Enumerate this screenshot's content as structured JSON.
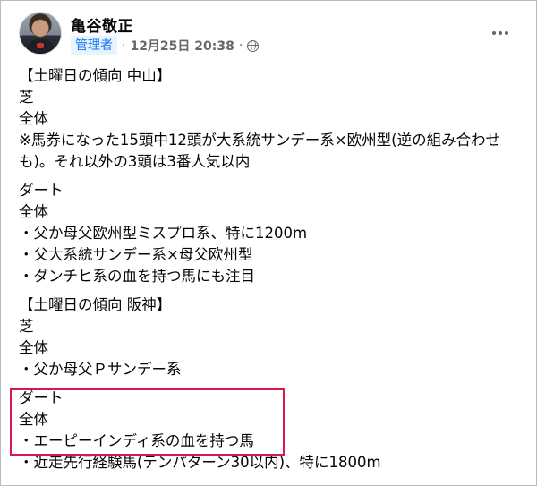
{
  "author": {
    "name": "亀谷敬正",
    "role_badge": "管理者",
    "separator": "·",
    "timestamp": "12月25日 20:38",
    "audience_icon": "globe-icon"
  },
  "post": {
    "sections": [
      {
        "lines": [
          "【土曜日の傾向 中山】",
          "芝",
          "全体",
          "※馬券になった15頭中12頭が大系統サンデー系×欧州型(逆の組み合わせも)。それ以外の3頭は3番人気以内"
        ]
      },
      {
        "lines": [
          "ダート",
          "全体",
          "・父か母父欧州型ミスプロ系、特に1200m",
          "・父大系統サンデー系×母父欧州型",
          "・ダンチヒ系の血を持つ馬にも注目"
        ]
      },
      {
        "lines": [
          "【土曜日の傾向 阪神】",
          "芝",
          "全体",
          "・父か母父Ｐサンデー系"
        ]
      },
      {
        "lines": [
          "ダート",
          "全体",
          "・エーピーインディ系の血を持つ馬",
          "・近走先行経験馬(テンパターン30以内)、特に1800m"
        ]
      }
    ]
  },
  "colors": {
    "highlight_border": "#d8184a",
    "badge_text": "#1877f2",
    "badge_bg": "#e7f3ff",
    "meta_text": "#65676b"
  }
}
